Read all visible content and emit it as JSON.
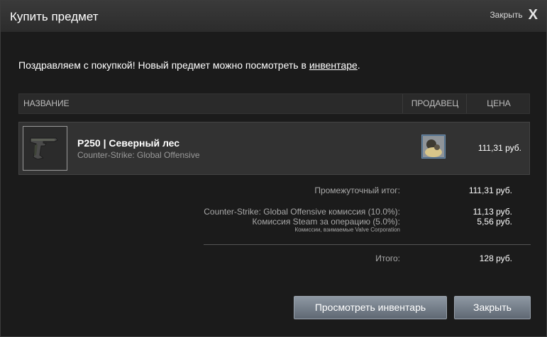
{
  "dialog": {
    "title": "Купить предмет",
    "close_label": "Закрыть",
    "close_icon": "X"
  },
  "message": {
    "before": "Поздравляем с покупкой! Новый предмет можно посмотреть в ",
    "link": "инвентаре",
    "after": "."
  },
  "table": {
    "headers": {
      "name": "НАЗВАНИЕ",
      "seller": "ПРОДАВЕЦ",
      "price": "ЦЕНА"
    },
    "item": {
      "name": "P250 | Северный лес",
      "game": "Counter-Strike: Global Offensive",
      "price": "111,31 руб.",
      "thumb_icon": "pistol-icon",
      "seller_icon": "seller-avatar-icon"
    }
  },
  "summary": {
    "subtotal_label": "Промежуточный итог:",
    "subtotal_value": "111,31 руб.",
    "game_fee_label": "Counter-Strike: Global Offensive комиссия (10.0%):",
    "game_fee_value": "11,13 руб.",
    "steam_fee_label": "Комиссия Steam за операцию (5.0%):",
    "steam_fee_value": "5,56 руб.",
    "fee_note": "Комиссии, взимаемые Valve Corporation",
    "total_label": "Итого:",
    "total_value": "128 руб."
  },
  "buttons": {
    "view_inventory": "Просмотреть инвентарь",
    "close": "Закрыть"
  },
  "colors": {
    "background": "#1b1b1b",
    "header": "#333333",
    "row": "#323232",
    "button": "#7a848f"
  }
}
